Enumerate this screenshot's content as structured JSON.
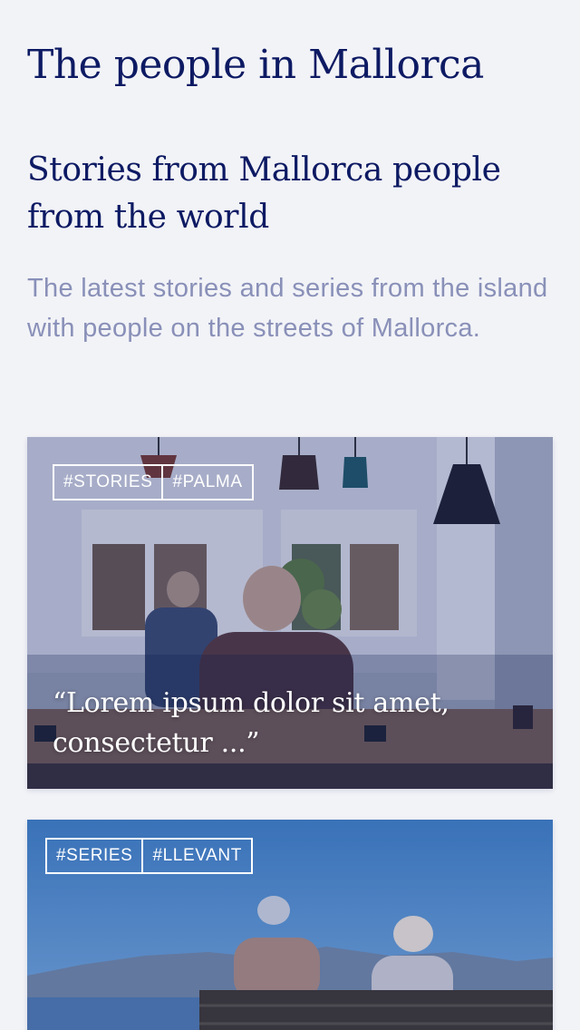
{
  "page": {
    "title": "The people in Mallorca"
  },
  "section": {
    "title": "Stories from Mallorca people from the world",
    "intro": "The latest stories and series from the island with people on the streets of Mallorca."
  },
  "cards": [
    {
      "tags": [
        "#STORIES",
        "#PALMA"
      ],
      "quote": "“Lorem ipsum dolor sit amet, consectetur ...”",
      "image": "cafe-photo"
    },
    {
      "tags": [
        "#SERIES",
        "#LLEVANT"
      ],
      "image": "seaside-bench-photo"
    }
  ],
  "colors": {
    "background": "#f2f3f7",
    "heading": "#0d1a63",
    "intro_text": "#8990b8",
    "overlay": "#1e2a78"
  }
}
